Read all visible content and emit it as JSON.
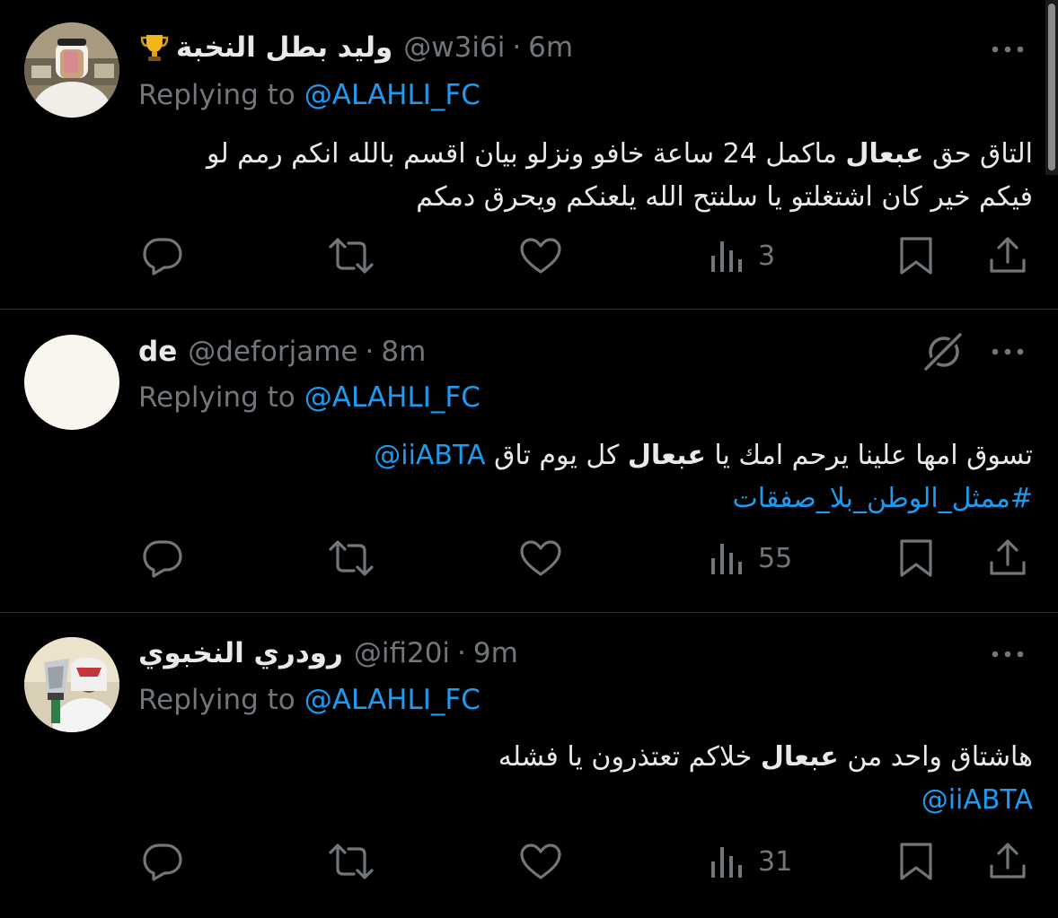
{
  "tweets": [
    {
      "display_name": "وليد بطل النخبة",
      "name_emoji_icon": "trophy-icon",
      "handle": "@w3i6i",
      "separator": "·",
      "time": "6m",
      "replying_prefix": "Replying to",
      "replying_to": "@ALAHLI_FC",
      "body_line1_pre": "التاق حق ",
      "body_line1_bold": "عبعال",
      "body_line1_post": " ماكمل 24 ساعة خافو ونزلو بيان اقسم بالله انكم رمم لو",
      "body_line2": "فيكم خير كان اشتغلتو يا سلنتح الله يلعنكم ويحرق دمكم",
      "views": "3"
    },
    {
      "display_name": "de",
      "handle": "@deforjame",
      "separator": "·",
      "time": "8m",
      "replying_prefix": "Replying to",
      "replying_to": "@ALAHLI_FC",
      "body_line1_pre": "تسوق امها علينا يرحم امك يا ",
      "body_line1_bold": "عبعال",
      "body_line1_post": " كل يوم تاق ",
      "body_line1_mention": "@iiABTA",
      "body_hashtag": "#ممثل_الوطن_بلا_صفقات",
      "views": "55"
    },
    {
      "display_name": "رودري النخبوي",
      "handle": "@ifi20i",
      "separator": "·",
      "time": "9m",
      "replying_prefix": "Replying to",
      "replying_to": "@ALAHLI_FC",
      "body_line1_pre": "هاشتاق واحد من ",
      "body_line1_bold": "عبعال",
      "body_line1_post": " خلاكم تعتذرون يا فشله",
      "body_mention": "@iiABTA",
      "views": "31"
    }
  ],
  "colors": {
    "background": "#000000",
    "text_primary": "#e7e9ea",
    "text_secondary": "#71767b",
    "link": "#1d9bf0",
    "divider": "#2f3336"
  },
  "icons": [
    "reply-icon",
    "retweet-icon",
    "like-icon",
    "views-icon",
    "bookmark-icon",
    "share-icon",
    "more-icon",
    "grok-icon"
  ]
}
